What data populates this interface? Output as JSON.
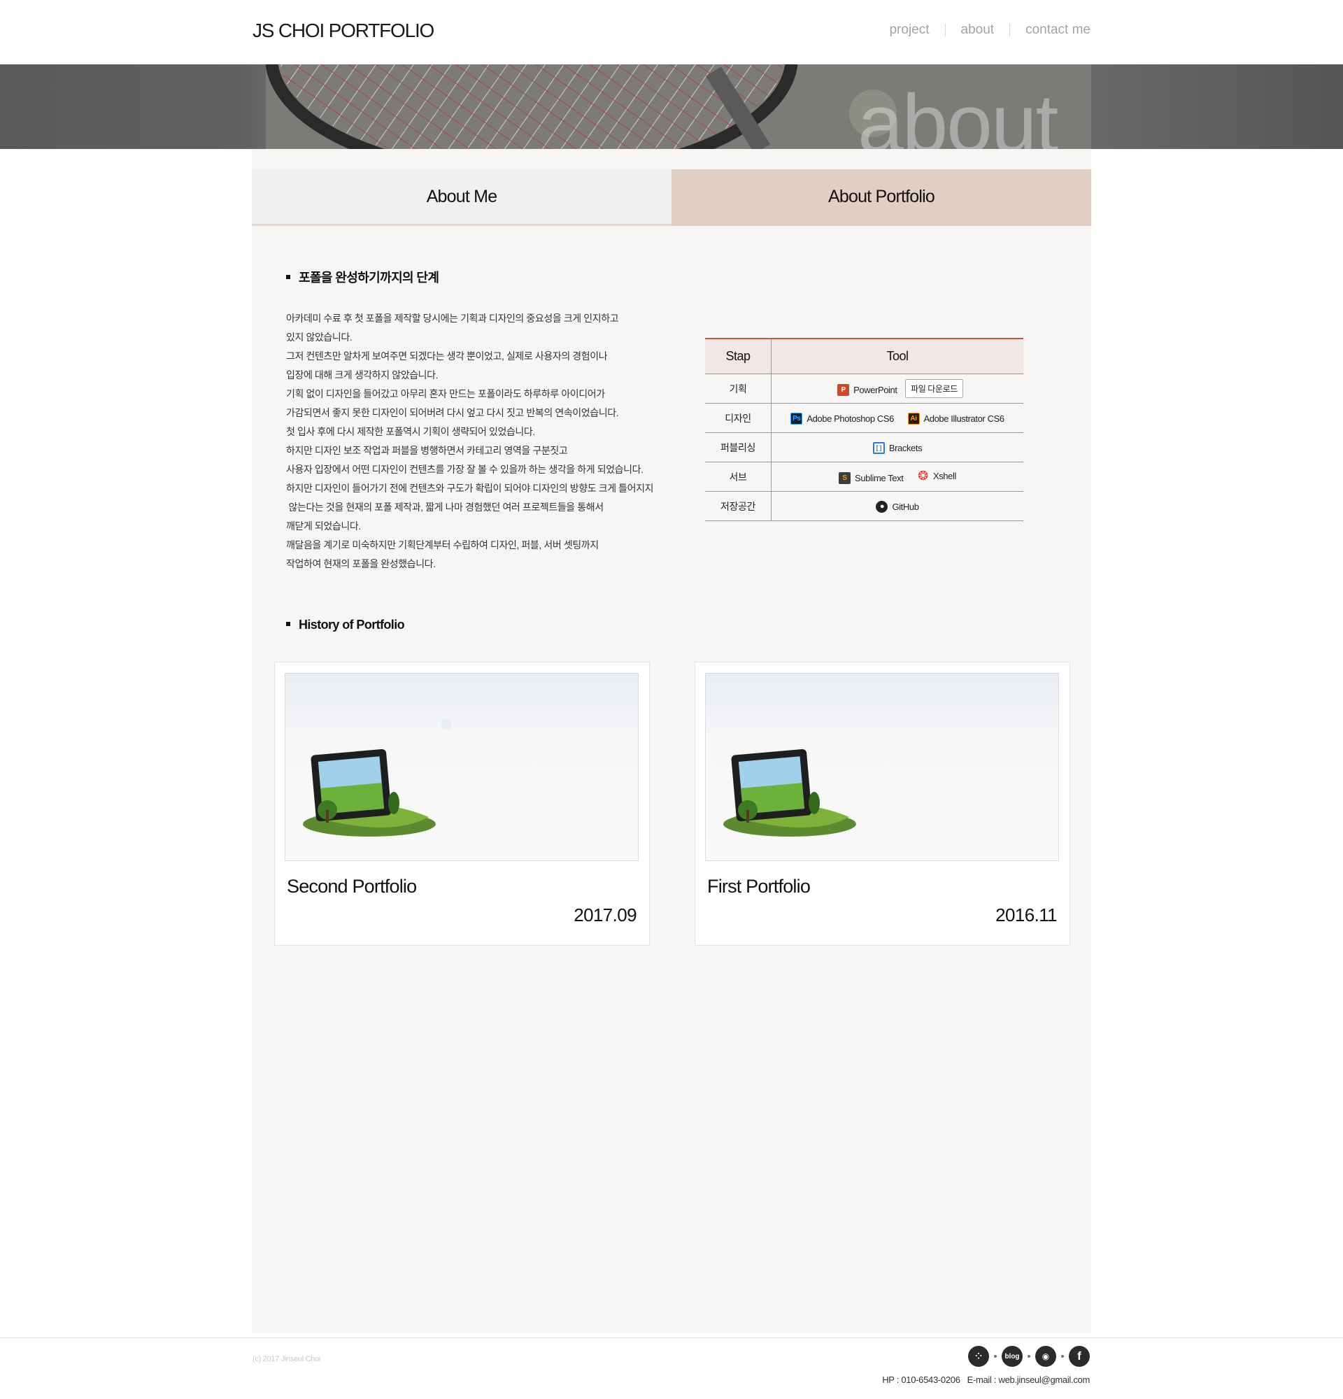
{
  "header": {
    "logo": "JS CHOI PORTFOLIO",
    "nav": [
      "project",
      "about",
      "contact me"
    ]
  },
  "hero": {
    "word": "about"
  },
  "tabs": {
    "about_me": "About Me",
    "about_portfolio": "About Portfolio"
  },
  "section1": {
    "title": "포폴을 완성하기까지의 단계",
    "lines": [
      "아카데미 수료 후 첫 포폴을 제작할 당시에는 기획과 디자인의 중요성을 크게 인지하고",
      "있지 않았습니다.",
      "그저 컨텐츠만 알차게 보여주면 되겠다는 생각 뿐이었고, 실제로 사용자의 경험이나",
      "입장에 대해  크게 생각하지 않았습니다.",
      "기획 없이 디자인을 들어갔고 아무리 혼자 만드는 포폴이라도 하루하루 아이디어가",
      "가감되면서 좋지 못한 디자인이 되어버려 다시 엎고 다시 짓고 반복의 연속이었습니다.",
      "첫 입사 후에 다시 제작한 포폴역시 기획이 생략되어 있었습니다.",
      "하지만 디자인 보조 작업과 퍼블을 병행하면서 카테고리 영역을 구분짓고",
      "사용자 입장에서 어떤 디자인이 컨텐츠를 가장 잘 볼 수 있을까 하는 생각을 하게 되었습니다.",
      "하지만 디자인이 들어가기 전에 컨텐츠와 구도가 확립이 되어야 디자인의 방향도 크게 틀어지지",
      " 않는다는 것을 현재의 포폴 제작과, 짧게 나마 경험했던 여러 프로젝트들을 통해서",
      "깨닫게 되었습니다.",
      "깨달음을 계기로 미숙하지만 기획단계부터 수립하여 디자인, 퍼블, 서버 셋팅까지",
      "작업하여 현재의 포폴을 완성했습니다."
    ]
  },
  "tool_table": {
    "headers": [
      "Stap",
      "Tool"
    ],
    "rows": [
      {
        "step": "기획",
        "tools": [
          {
            "name": "PowerPoint",
            "icon": "powerpoint-icon",
            "glyph": "P"
          }
        ],
        "button": "파일 다운로드"
      },
      {
        "step": "디자인",
        "tools": [
          {
            "name": "Adobe Photoshop CS6",
            "icon": "photoshop-icon",
            "glyph": "Ps"
          },
          {
            "name": "Adobe Illustrator CS6",
            "icon": "illustrator-icon",
            "glyph": "Ai"
          }
        ]
      },
      {
        "step": "퍼블리싱",
        "tools": [
          {
            "name": "Brackets",
            "icon": "brackets-icon",
            "glyph": "[ ]"
          }
        ]
      },
      {
        "step": "서브",
        "tools": [
          {
            "name": "Sublime Text",
            "icon": "sublime-icon",
            "glyph": "S"
          },
          {
            "name": "Xshell",
            "icon": "xshell-icon",
            "glyph": "❂"
          }
        ]
      },
      {
        "step": "저장공간",
        "tools": [
          {
            "name": "GitHub",
            "icon": "github-icon",
            "glyph": "●"
          }
        ]
      }
    ]
  },
  "section2": {
    "title": "History of Portfolio"
  },
  "cards": [
    {
      "title": "Second Portfolio",
      "date": "2017.09"
    },
    {
      "title": "First Portfolio",
      "date": "2016.11"
    }
  ],
  "footer": {
    "copyright": "(c) 2017 Jinseul Choi",
    "social": [
      {
        "icon": "dots-icon",
        "glyph": "⁘"
      },
      {
        "icon": "blog-icon",
        "glyph": "blog"
      },
      {
        "icon": "github-icon",
        "glyph": "◉"
      },
      {
        "icon": "facebook-icon",
        "glyph": "f"
      }
    ],
    "contact": "HP : 010-6543-0206   E-mail : web.jinseul@gmail.com"
  },
  "colors": {
    "accent_line": "#c0584a",
    "active_tab": "#e2cfc4",
    "inactive_tab": "#eff0f2",
    "panel": "#f7f6f4"
  }
}
